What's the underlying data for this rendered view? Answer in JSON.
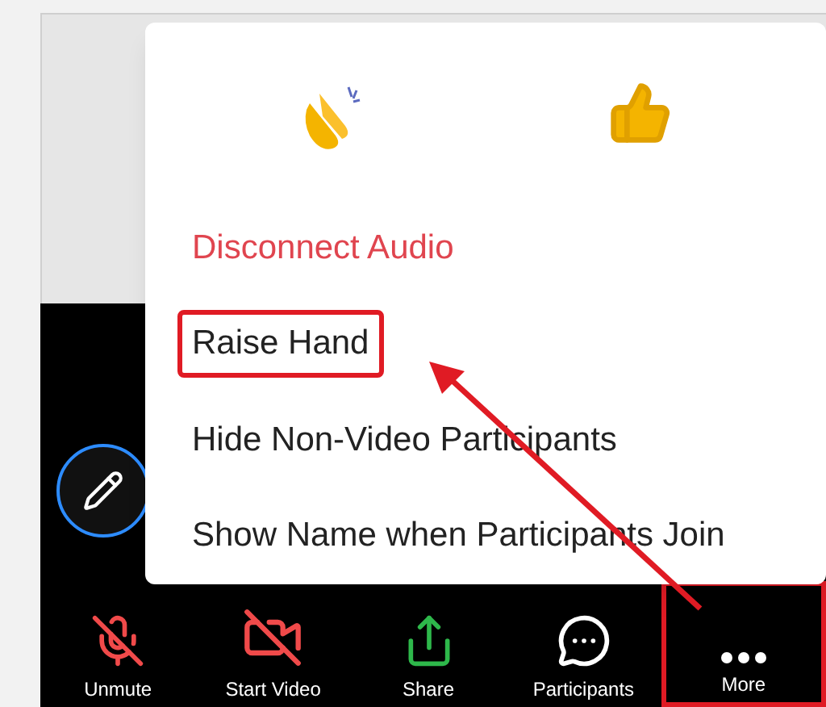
{
  "reactions": [
    {
      "kind": "clap"
    },
    {
      "kind": "thumbs_up"
    }
  ],
  "menu_items": [
    {
      "label": "Disconnect Audio",
      "kind": "destructive",
      "highlighted": false
    },
    {
      "label": "Raise Hand",
      "kind": "normal",
      "highlighted": true
    },
    {
      "label": "Hide Non-Video Participants",
      "kind": "normal",
      "highlighted": false
    },
    {
      "label": "Show Name when Participants Join",
      "kind": "normal",
      "highlighted": false
    }
  ],
  "toolbar": [
    {
      "label": "Unmute",
      "kind": "mic_off",
      "highlighted": false
    },
    {
      "label": "Start Video",
      "kind": "video_off",
      "highlighted": false
    },
    {
      "label": "Share",
      "kind": "share",
      "highlighted": false
    },
    {
      "label": "Participants",
      "kind": "chat",
      "highlighted": false
    },
    {
      "label": "More",
      "kind": "more",
      "highlighted": true
    }
  ]
}
